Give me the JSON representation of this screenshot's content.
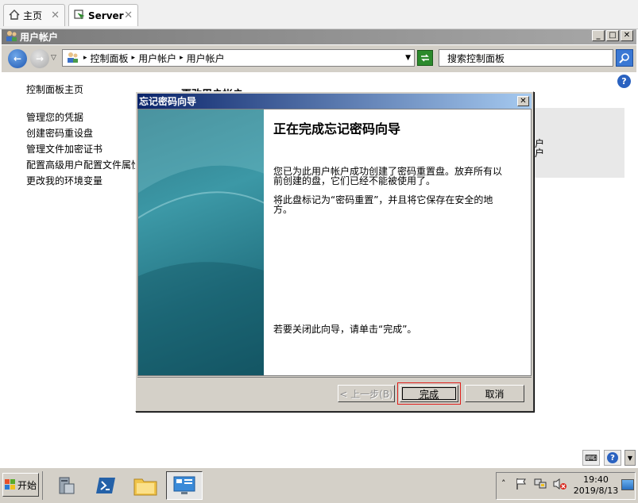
{
  "tabs": [
    {
      "label": "主页",
      "close": "✕"
    },
    {
      "label": "Server",
      "close": "✕"
    }
  ],
  "window": {
    "title": "用户帐户"
  },
  "address": {
    "crumbs": [
      "控制面板",
      "用户帐户",
      "用户帐户"
    ],
    "search_placeholder": "搜索控制面板"
  },
  "left_pane": {
    "home": "控制面板主页",
    "links": [
      "管理您的凭据",
      "创建密码重设盘",
      "管理文件加密证书",
      "配置高级用户配置文件属性",
      "更改我的环境变量"
    ]
  },
  "background_text": {
    "heading_partial": "更改用户帐户",
    "right_fragment": [
      "户",
      "户"
    ]
  },
  "dialog": {
    "title": "忘记密码向导",
    "heading": "正在完成忘记密码向导",
    "p1": "您已为此用户帐户成功创建了密码重置盘。放弃所有以前创建的盘，它们已经不能被使用了。",
    "p2": "将此盘标记为“密码重置”，并且将它保存在安全的地方。",
    "p3": "若要关闭此向导，请单击“完成”。",
    "buttons": {
      "back": "< 上一步(B)",
      "finish": "完成",
      "cancel": "取消"
    }
  },
  "taskbar": {
    "start": "开始",
    "time": "19:40",
    "date": "2019/8/13"
  },
  "colors": {
    "dialog_title_from": "#0a246a",
    "dialog_title_to": "#a6caf0",
    "finish_highlight": "#e0201c",
    "link": "#000000"
  }
}
